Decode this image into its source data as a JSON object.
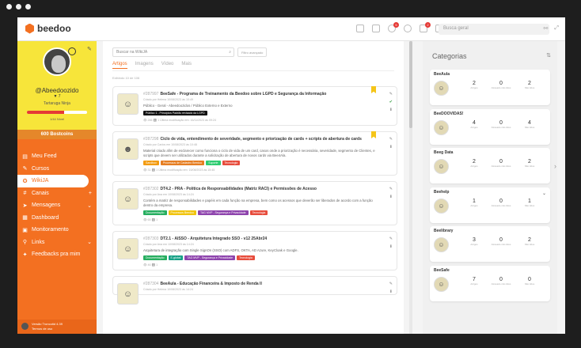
{
  "topbar": {
    "logo_text": "beedoo",
    "logo_sub": "by onefly",
    "notif_badge": "5",
    "msg_badge": "2",
    "search_placeholder": "Busca geral"
  },
  "sidebar": {
    "user_name": "@Abeedoozido",
    "level": "7",
    "title": "Tartaruga Ninja",
    "progress_fraction": 0.62,
    "progress_label": "1/44 Nível",
    "bostcoins": "600 Bostcoins",
    "menu": [
      {
        "label": "Meu Feed",
        "icon": "feed-icon",
        "glyph": "▤"
      },
      {
        "label": "Cursos",
        "icon": "graduation-icon",
        "glyph": "✎"
      },
      {
        "label": "WikiJA",
        "icon": "wiki-icon",
        "glyph": "✪",
        "active": true
      },
      {
        "label": "Canais",
        "icon": "hashtag-icon",
        "glyph": "#",
        "extra": "+"
      },
      {
        "label": "Mensagens",
        "icon": "paper-plane-icon",
        "glyph": "➤",
        "extra": "⌄"
      },
      {
        "label": "Dashboard",
        "icon": "dashboard-icon",
        "glyph": "▦"
      },
      {
        "label": "Monitoramento",
        "icon": "monitor-icon",
        "glyph": "▣"
      },
      {
        "label": "Links",
        "icon": "link-icon",
        "glyph": "⚲",
        "extra": "⌄"
      },
      {
        "label": "Feedbacks pra mim",
        "icon": "thumbs-up-icon",
        "glyph": "✦"
      }
    ],
    "footer_line1": "Versão Troncoitd 4.39",
    "footer_line2": "Termos de uso"
  },
  "main": {
    "search_placeholder": "Buscar na WikiJA",
    "filter_label": "Filtro avançado",
    "tabs": [
      {
        "label": "Artigos",
        "active": true
      },
      {
        "label": "Imagens"
      },
      {
        "label": "Vídeo"
      },
      {
        "label": "Mais"
      }
    ],
    "showing_text": "Exibindo 10 de 106",
    "articles": [
      {
        "id": "#287997",
        "title": "BeeSafe - Programa de Treinamento da Beedoo sobre LGPD e Segurança da Informação",
        "meta": "Criado por Helena 10/08/2023 às 10:49",
        "desc": "Público - Geral - Abeedoozidos / Público Externo e Externo",
        "tags": [
          {
            "text": "Público 1 - Princípios Padrão revisado da LGPD",
            "color": "#111111"
          }
        ],
        "foot": "👁 266   ⬇ 1   Última modificação em: 16/11/2023 às 09:24",
        "bookmark": true,
        "thumb_glyph": "☺"
      },
      {
        "id": "#287298",
        "title": "Ciclo de vida, entendimento de severidade, segmento e priorização de cards + scripts de abertura de cards",
        "meta": "Criado por Carlos em 10/08/2023 às 10:48",
        "desc": "Material criado afim de esclarecer como funciona o ciclo de vida de um card, casos onde a priorização é necessária, severidade, segmento de Clientes, e scripts que devem ser utilizados durante a solicitação de abertura de novos cards via Bee4Ala.",
        "tags": [
          {
            "text": "Sandbox",
            "color": "#f39c12"
          },
          {
            "text": "Processos de Cadastro Beedoo",
            "color": "#e67e22"
          },
          {
            "text": "Suporte",
            "color": "#2ecc71"
          },
          {
            "text": "Tecnologia",
            "color": "#e74c3c"
          }
        ],
        "foot": "👁 31   ⬇ 1   Última modificação em: 15/08/2023 às 15:45",
        "bookmark": true,
        "thumb_glyph": "☻"
      },
      {
        "id": "#287302",
        "title": "DT4.2 - PRA - Política de Responsabilidades (Matriz RACI) e Permissões de Acesso",
        "meta": "Criado por Ana em 10/08/2023 às 14:24",
        "desc": "Contém a matriz de responsabilidades e papéis em cada função na empresa, bem como os acessos que deverão ser liberados de acordo com a função dentro da empresa.",
        "tags": [
          {
            "text": "Documentação",
            "color": "#27ae60"
          },
          {
            "text": "Processos Beedoo",
            "color": "#f1c40f"
          },
          {
            "text": "TAG MVP - Segurança e Privacidade",
            "color": "#8e44ad"
          },
          {
            "text": "Tecnologia",
            "color": "#e74c3c"
          }
        ],
        "foot": "👁 65   ⬇ 1",
        "bookmark": false,
        "thumb_glyph": "☺"
      },
      {
        "id": "#287303",
        "title": "DT2.1 - AISSO - Arquitetura Integrado SSO - v12 25Abr24",
        "meta": "Criado por Ana em 10/08/2023 às 14:24",
        "desc": "Arquitetura de integração com Single SignOn (SSO) com ADFS, OKTA, AD Azure, KeyCloak e Google.",
        "tags": [
          {
            "text": "Documentação",
            "color": "#27ae60"
          },
          {
            "text": "E-global",
            "color": "#16a085"
          },
          {
            "text": "TAG MVP - Segurança e Privacidade",
            "color": "#8e44ad"
          },
          {
            "text": "Tecnologia",
            "color": "#e74c3c"
          }
        ],
        "foot": "👁 46   ⬇ 1",
        "bookmark": false,
        "thumb_glyph": "☺"
      },
      {
        "id": "#287304",
        "title": "BeeAula - Educação Financeira & Imposto de Renda II",
        "meta": "Criado por Helena 10/08/2023 às 14:24",
        "desc": "",
        "tags": [],
        "foot": "",
        "bookmark": false,
        "thumb_glyph": "☺"
      }
    ]
  },
  "categories": {
    "title": "Categorias",
    "labels": {
      "artigos": "Artigos",
      "atrasado": "Atrasado não lidos",
      "nao_lidos": "Não lidos"
    },
    "items": [
      {
        "name": "BeeAula",
        "artigos": "2",
        "atrasado": "0",
        "nao_lidos": "2",
        "chevron": false
      },
      {
        "name": "BeeDOOVIDAS!",
        "artigos": "4",
        "atrasado": "0",
        "nao_lidos": "4",
        "chevron": false
      },
      {
        "name": "Beeg Data",
        "artigos": "2",
        "atrasado": "0",
        "nao_lidos": "2",
        "chevron": false
      },
      {
        "name": "Beehelp",
        "artigos": "1",
        "atrasado": "0",
        "nao_lidos": "1",
        "chevron": true
      },
      {
        "name": "Beelibrary",
        "artigos": "3",
        "atrasado": "0",
        "nao_lidos": "2",
        "chevron": false
      },
      {
        "name": "BeeSafe",
        "artigos": "7",
        "atrasado": "0",
        "nao_lidos": "0",
        "chevron": false
      }
    ]
  }
}
